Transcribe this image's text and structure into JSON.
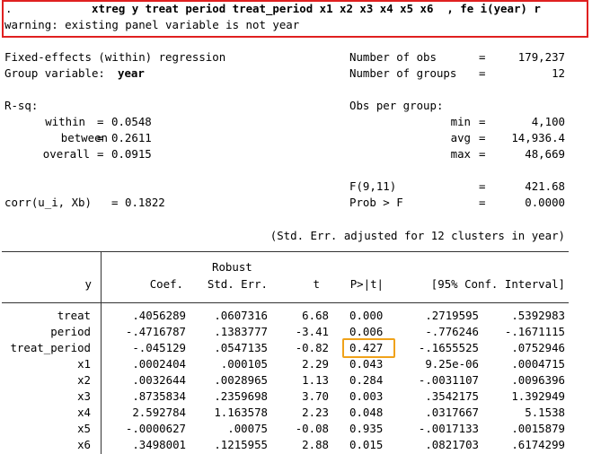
{
  "command": {
    "prompt": ".",
    "text": "xtreg y treat period treat_period x1 x2 x3 x4 x5 x6  , fe i(year) r",
    "warning": "warning: existing panel variable is not year"
  },
  "header": {
    "model": "Fixed-effects (within) regression",
    "group_label": "Group variable:",
    "group_var": "year",
    "nobs_label": "Number of obs",
    "nobs": "179,237",
    "ngroups_label": "Number of groups",
    "ngroups": "12",
    "rsq_label": "R-sq:",
    "obs_per_group_label": "Obs per group:",
    "within_label": "within",
    "within": "0.0548",
    "between_label": "between",
    "between": "0.2611",
    "overall_label": "overall",
    "overall": "0.0915",
    "min_label": "min",
    "min": "4,100",
    "avg_label": "avg",
    "avg": "14,936.4",
    "max_label": "max",
    "max": "48,669",
    "f_label": "F(9,11)",
    "f_value": "421.68",
    "prob_label": "Prob > F",
    "prob_value": "0.0000",
    "corr_label": "corr(u_i, Xb)",
    "corr_value": "0.1822",
    "eq": "=",
    "se_note": "(Std. Err. adjusted for 12 clusters in year)"
  },
  "table": {
    "col_robust": "Robust",
    "col_y": "y",
    "col_coef": "Coef.",
    "col_se": "Std. Err.",
    "col_t": "t",
    "col_p": "P>|t|",
    "col_ci": "[95% Conf. Interval]",
    "rows": [
      {
        "var": "treat",
        "coef": ".4056289",
        "se": ".0607316",
        "t": "6.68",
        "p": "0.000",
        "lo": ".2719595",
        "hi": ".5392983"
      },
      {
        "var": "period",
        "coef": "-.4716787",
        "se": ".1383777",
        "t": "-3.41",
        "p": "0.006",
        "lo": "-.776246",
        "hi": "-.1671115"
      },
      {
        "var": "treat_period",
        "coef": "-.045129",
        "se": ".0547135",
        "t": "-0.82",
        "p": "0.427",
        "lo": "-.1655525",
        "hi": ".0752946"
      },
      {
        "var": "x1",
        "coef": ".0002404",
        "se": ".000105",
        "t": "2.29",
        "p": "0.043",
        "lo": "9.25e-06",
        "hi": ".0004715"
      },
      {
        "var": "x2",
        "coef": ".0032644",
        "se": ".0028965",
        "t": "1.13",
        "p": "0.284",
        "lo": "-.0031107",
        "hi": ".0096396"
      },
      {
        "var": "x3",
        "coef": ".8735834",
        "se": ".2359698",
        "t": "3.70",
        "p": "0.003",
        "lo": ".3542175",
        "hi": "1.392949"
      },
      {
        "var": "x4",
        "coef": "2.592784",
        "se": "1.163578",
        "t": "2.23",
        "p": "0.048",
        "lo": ".0317667",
        "hi": "5.1538"
      },
      {
        "var": "x5",
        "coef": "-.0000627",
        "se": ".00075",
        "t": "-0.08",
        "p": "0.935",
        "lo": "-.0017133",
        "hi": ".0015879"
      },
      {
        "var": "x6",
        "coef": ".3498001",
        "se": ".1215955",
        "t": "2.88",
        "p": "0.015",
        "lo": ".0821703",
        "hi": ".6174299"
      }
    ]
  }
}
